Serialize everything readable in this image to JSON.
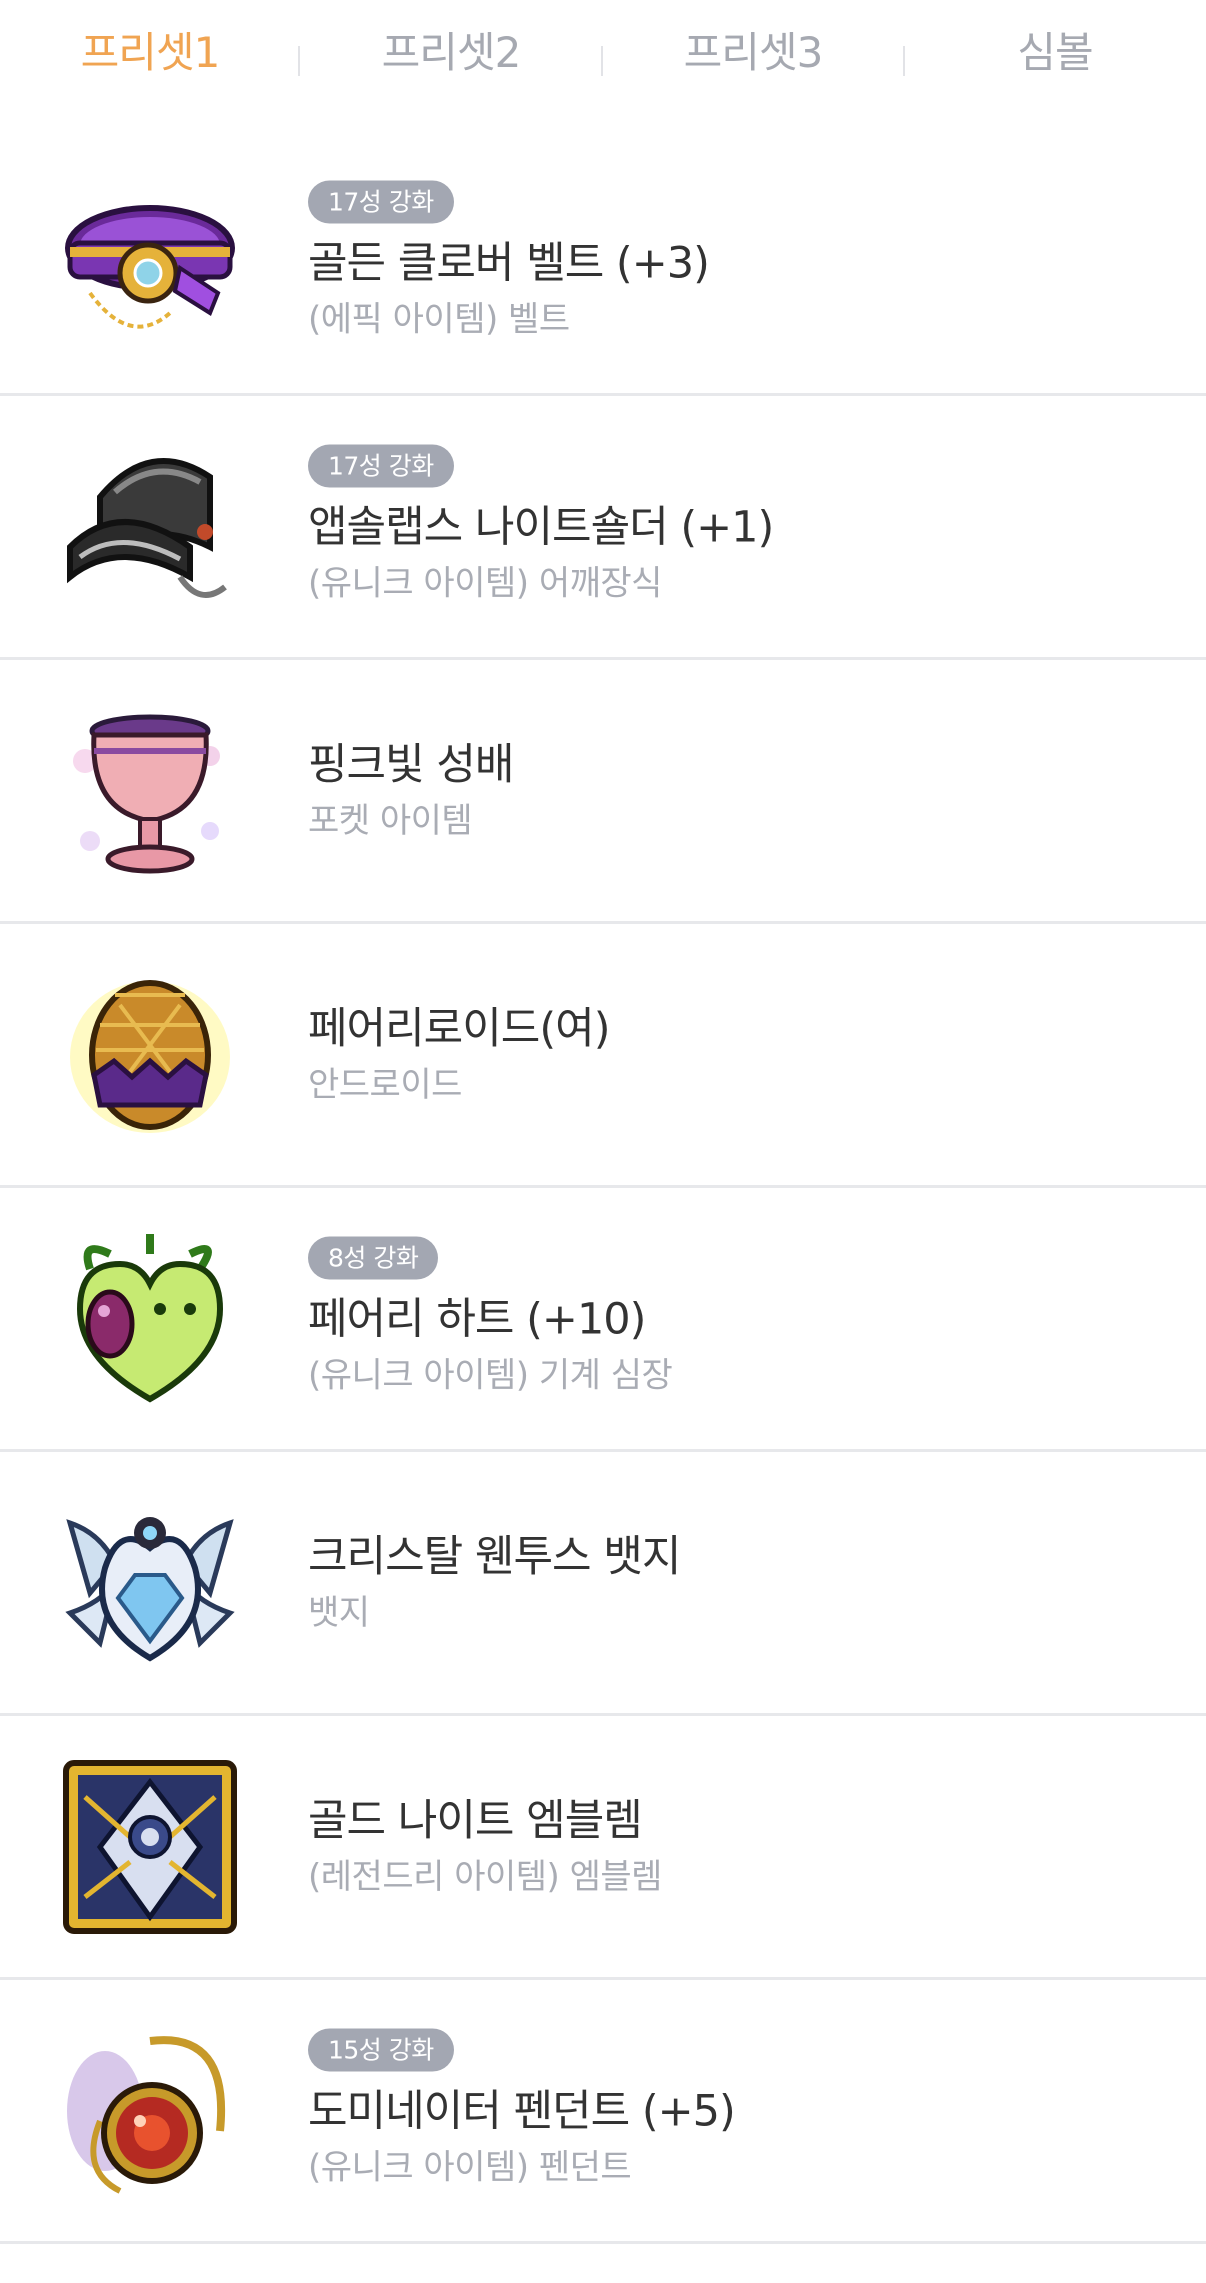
{
  "tabs": [
    {
      "label": "프리셋1",
      "active": true
    },
    {
      "label": "프리셋2",
      "active": false
    },
    {
      "label": "프리셋3",
      "active": false
    },
    {
      "label": "심볼",
      "active": false
    }
  ],
  "colors": {
    "active_tab": "#f0a452",
    "inactive_tab": "#a6a9b1",
    "badge": "#a3a7b2",
    "divider": "#e7e8eb"
  },
  "items": [
    {
      "icon": "belt-icon",
      "badge": "17성 강화",
      "name": "골든 클로버 벨트 (+3)",
      "type": "(에픽 아이템) 벨트"
    },
    {
      "icon": "shoulder-icon",
      "badge": "17성 강화",
      "name": "앱솔랩스 나이트숄더 (+1)",
      "type": "(유니크 아이템) 어깨장식"
    },
    {
      "icon": "chalice-icon",
      "badge": "",
      "name": "핑크빛 성배",
      "type": "포켓 아이템"
    },
    {
      "icon": "egg-icon",
      "badge": "",
      "name": "페어리로이드(여)",
      "type": "안드로이드"
    },
    {
      "icon": "heart-icon",
      "badge": "8성 강화",
      "name": "페어리 하트 (+10)",
      "type": "(유니크 아이템) 기계 심장"
    },
    {
      "icon": "badge-icon",
      "badge": "",
      "name": "크리스탈 웬투스 뱃지",
      "type": "뱃지"
    },
    {
      "icon": "emblem-icon",
      "badge": "",
      "name": "골드 나이트 엠블렘",
      "type": "(레전드리 아이템) 엠블렘"
    },
    {
      "icon": "pendant-icon",
      "badge": "15성 강화",
      "name": "도미네이터 펜던트 (+5)",
      "type": "(유니크 아이템) 펜던트"
    }
  ]
}
